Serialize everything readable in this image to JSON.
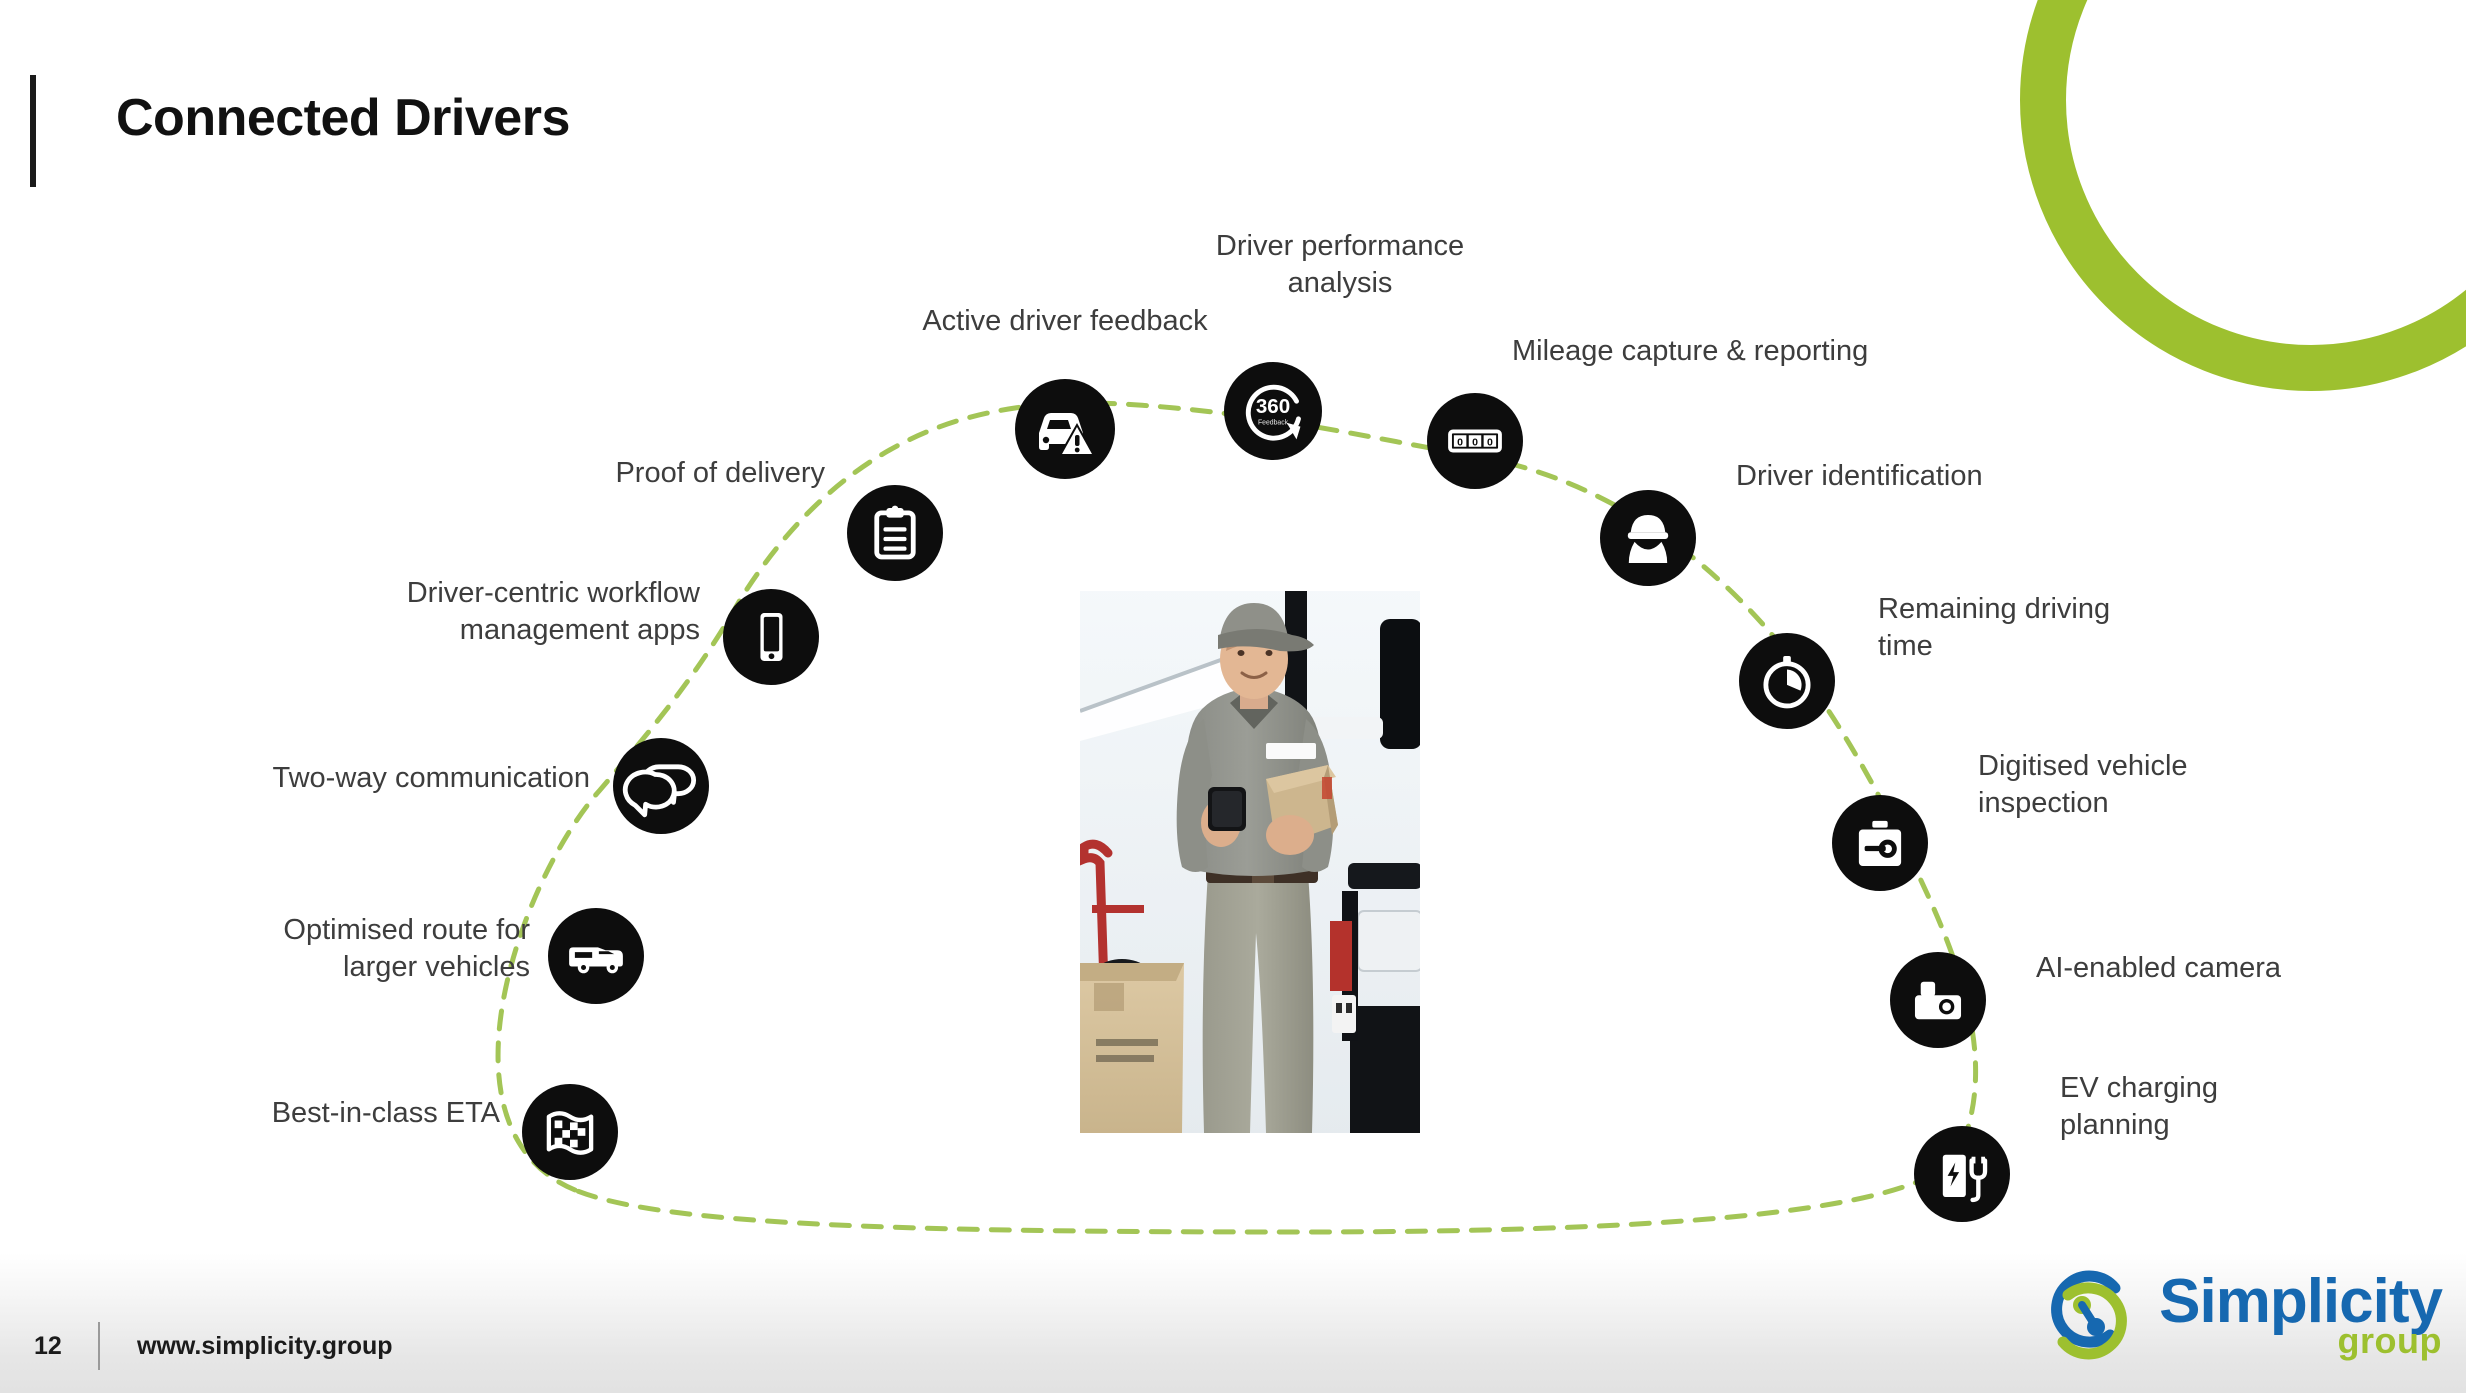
{
  "slide": {
    "title": "Connected Drivers",
    "accent_green": "#9dc02f",
    "line_green": "#a3c556",
    "node_black": "#0d0d0d",
    "label_color": "#3d3d3d"
  },
  "center_photo": {
    "alt": "Delivery driver in grey uniform and cap holding a smartphone and a parcel in front of a white delivery van, with cardboard boxes and a red hand truck"
  },
  "nodes": [
    {
      "id": "driver-performance-analysis",
      "label": "Driver performance\nanalysis",
      "icon": "360-degree-icon",
      "icon_text": "360",
      "icon_subtext": "Feedback"
    },
    {
      "id": "active-driver-feedback",
      "label": "Active driver feedback",
      "icon": "car-warning-icon"
    },
    {
      "id": "proof-of-delivery",
      "label": "Proof of delivery",
      "icon": "clipboard-icon"
    },
    {
      "id": "driver-centric-workflow-management-apps",
      "label": "Driver-centric workflow\nmanagement apps",
      "icon": "smartphone-icon"
    },
    {
      "id": "two-way-communication",
      "label": "Two-way communication",
      "icon": "speech-bubbles-icon"
    },
    {
      "id": "optimised-route-for-larger-vehicles",
      "label": "Optimised route for\nlarger vehicles",
      "icon": "van-icon"
    },
    {
      "id": "best-in-class-eta",
      "label": "Best-in-class ETA",
      "icon": "checkered-map-icon"
    },
    {
      "id": "mileage-capture-reporting",
      "label": "Mileage capture & reporting",
      "icon": "odometer-icon",
      "icon_text": "0 0 0"
    },
    {
      "id": "driver-identification",
      "label": "Driver identification",
      "icon": "driver-cap-icon"
    },
    {
      "id": "remaining-driving-time",
      "label": "Remaining driving\ntime",
      "icon": "stopwatch-icon"
    },
    {
      "id": "digitised-vehicle-inspection",
      "label": "Digitised vehicle\ninspection",
      "icon": "toolbox-icon"
    },
    {
      "id": "ai-enabled-camera",
      "label": "AI-enabled camera",
      "icon": "dashcam-icon"
    },
    {
      "id": "ev-charging-planning",
      "label": "EV charging\nplanning",
      "icon": "ev-charger-icon"
    }
  ],
  "footer": {
    "page_number": "12",
    "url": "www.simplicity.group"
  },
  "logo": {
    "name": "Simplicity",
    "sub": "group",
    "name_color": "#1668b0",
    "sub_color": "#9dc02f"
  }
}
